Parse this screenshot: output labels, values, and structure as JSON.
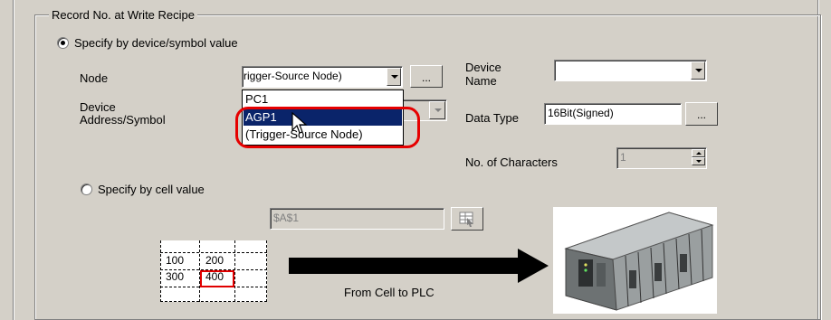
{
  "group_title": "Record No. at Write Recipe",
  "radio_device": {
    "label": "Specify by device/symbol value",
    "checked": true
  },
  "node": {
    "label": "Node",
    "value": "rigger-Source Node)",
    "browse": "..."
  },
  "device_address": {
    "label_line1": "Device",
    "label_line2": "Address/Symbol"
  },
  "dropdown": {
    "items": [
      "PC1",
      "AGP1",
      "(Trigger-Source Node)"
    ],
    "selected": "AGP1"
  },
  "device_name": {
    "label_line1": "Device",
    "label_line2": "Name",
    "value": ""
  },
  "data_type": {
    "label": "Data Type",
    "value": "16Bit(Signed)",
    "browse": "..."
  },
  "chars": {
    "label": "No. of Characters",
    "value": "1"
  },
  "radio_cell": {
    "label": "Specify by cell value",
    "checked": false
  },
  "cell_field": {
    "value": "$A$1"
  },
  "illustration": {
    "cells": [
      "100",
      "200",
      "300",
      "400"
    ],
    "caption": "From Cell to PLC"
  }
}
